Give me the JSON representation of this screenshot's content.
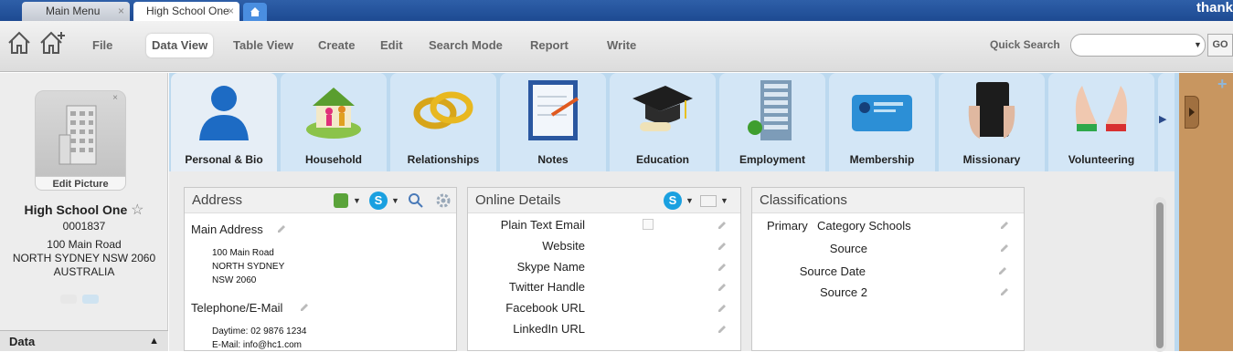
{
  "window_tabs": [
    {
      "label": "Main Menu"
    },
    {
      "label": "High School One"
    }
  ],
  "brand": "thank",
  "toolbar": {
    "items": [
      {
        "label": "File"
      },
      {
        "label": "Data View"
      },
      {
        "label": "Table View"
      },
      {
        "label": "Create"
      },
      {
        "label": "Edit"
      },
      {
        "label": "Search Mode"
      },
      {
        "label": "Report"
      },
      {
        "label": "Write"
      }
    ],
    "active": "Data View",
    "quick_search_label": "Quick Search",
    "quick_search_value": "",
    "go_label": "GO"
  },
  "record": {
    "edit_picture_label": "Edit Picture",
    "name": "High School One",
    "id": "0001837",
    "address_line1": "100 Main Road",
    "address_line2": "NORTH SYDNEY NSW 2060",
    "country": "AUSTRALIA"
  },
  "sidebar_section": {
    "label": "Data"
  },
  "modules": [
    {
      "label": "Personal & Bio",
      "icon": "person-icon"
    },
    {
      "label": "Household",
      "icon": "household-icon"
    },
    {
      "label": "Relationships",
      "icon": "rings-icon"
    },
    {
      "label": "Notes",
      "icon": "notes-icon"
    },
    {
      "label": "Education",
      "icon": "graduation-cap-icon"
    },
    {
      "label": "Employment",
      "icon": "office-building-icon"
    },
    {
      "label": "Membership",
      "icon": "membership-card-icon"
    },
    {
      "label": "Missionary",
      "icon": "bible-icon"
    },
    {
      "label": "Volunteering",
      "icon": "helping-hands-icon"
    }
  ],
  "address_panel": {
    "title": "Address",
    "main_address_label": "Main Address",
    "main_address_lines": [
      "100 Main Road",
      "NORTH SYDNEY",
      "NSW 2060"
    ],
    "telephone_label": "Telephone/E-Mail",
    "telephone_lines": [
      "Daytime: 02 9876 1234",
      "E-Mail: info@hc1.com"
    ]
  },
  "online_panel": {
    "title": "Online Details",
    "fields": [
      {
        "label": "Plain Text Email"
      },
      {
        "label": "Website"
      },
      {
        "label": "Skype Name"
      },
      {
        "label": "Twitter Handle"
      },
      {
        "label": "Facebook URL"
      },
      {
        "label": "LinkedIn URL"
      }
    ]
  },
  "classifications_panel": {
    "title": "Classifications",
    "rows": [
      {
        "label": "Primary",
        "value": "Category Schools"
      },
      {
        "label": "Source",
        "value": ""
      },
      {
        "label": "Source Date",
        "value": ""
      },
      {
        "label": "Source 2",
        "value": ""
      }
    ]
  },
  "colors": {
    "title_bar": "#1d4a92",
    "content_bg": "#bcd9ef",
    "panel_bg": "#ebebeb",
    "cork": "#c89660"
  }
}
